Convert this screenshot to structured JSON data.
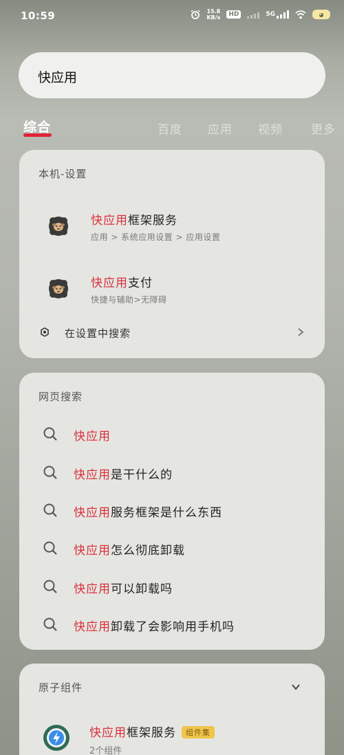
{
  "status_bar": {
    "time": "10:59",
    "speed_value": "15.8",
    "speed_unit": "KB/s",
    "hd_label": "HD",
    "network": "5G"
  },
  "search": {
    "query": "快应用"
  },
  "tabs": [
    {
      "label": "综合",
      "active": true
    },
    {
      "label": "百度",
      "active": false
    },
    {
      "label": "应用",
      "active": false
    },
    {
      "label": "视频",
      "active": false
    },
    {
      "label": "更多",
      "active": false
    }
  ],
  "settings_card": {
    "title": "本机-设置",
    "items": [
      {
        "highlight": "快应用",
        "rest": "框架服务",
        "subtitle": "应用 > 系统应用设置 > 应用设置",
        "icon": "sheep-gear-icon"
      },
      {
        "highlight": "快应用",
        "rest": "支付",
        "subtitle": "快捷与辅助>无障碍",
        "icon": "sheep-gear-icon"
      }
    ],
    "search_in_settings": "在设置中搜索"
  },
  "web_card": {
    "title": "网页搜索",
    "items": [
      {
        "highlight": "快应用",
        "rest": ""
      },
      {
        "highlight": "快应用",
        "rest": "是干什么的"
      },
      {
        "highlight": "快应用",
        "rest": "服务框架是什么东西"
      },
      {
        "highlight": "快应用",
        "rest": "怎么彻底卸载"
      },
      {
        "highlight": "快应用",
        "rest": "可以卸载吗"
      },
      {
        "highlight": "快应用",
        "rest": "卸载了会影响用手机吗"
      }
    ]
  },
  "atom_card": {
    "title": "原子组件",
    "item": {
      "highlight": "快应用",
      "rest": "框架服务",
      "badge": "组件集",
      "subtitle": "2个组件"
    }
  },
  "colors": {
    "accent": "#e0243a",
    "highlight_text": "#d9303c",
    "card_bg": "#e5e6e2"
  }
}
